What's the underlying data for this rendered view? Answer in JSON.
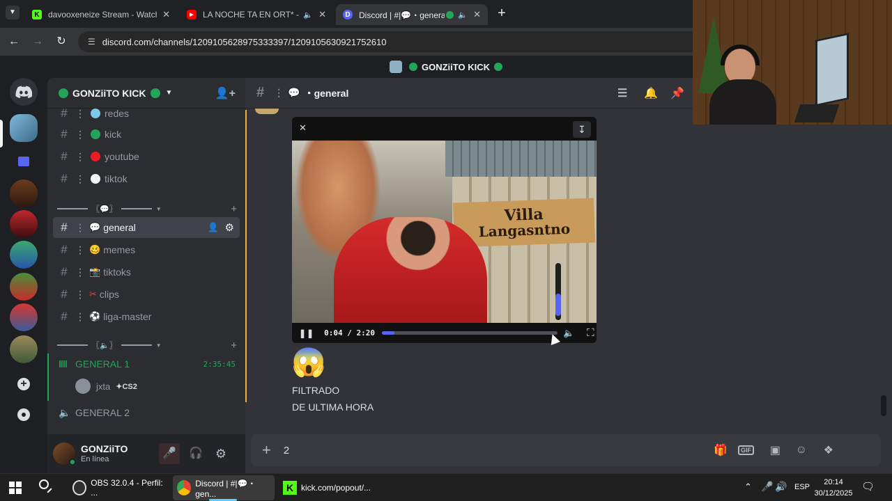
{
  "browser": {
    "tabs": [
      {
        "title": "davooxeneize Stream - Watch Li",
        "favicon": "K",
        "fav_color": "#53fc18",
        "active": false
      },
      {
        "title": "LA NOCHE TA EN ORT* - TU",
        "favicon": "▶",
        "fav_color": "#ff0000",
        "active": false
      },
      {
        "title": "Discord | #|💬・general | ",
        "favicon": "D",
        "fav_color": "#5865f2",
        "active": true
      }
    ],
    "new_tab": "+",
    "url": "discord.com/channels/1209105628975333397/1209105630921752610"
  },
  "server_banner": {
    "name": "GONZiiTO KICK"
  },
  "sidebar": {
    "server_name": "GONZiiTO KICK",
    "channels_top": [
      {
        "name": "redes",
        "emoji_color": "#7fc8e8"
      },
      {
        "name": "kick",
        "emoji_color": "#23a559"
      },
      {
        "name": "youtube",
        "emoji_color": "#ed1c24"
      },
      {
        "name": "tiktok",
        "emoji_color": "#f2f3f5"
      }
    ],
    "channels_mid": [
      {
        "name": "general",
        "emoji": "💬",
        "selected": true
      },
      {
        "name": "memes",
        "emoji": "🥴"
      },
      {
        "name": "tiktoks",
        "emoji": "📸"
      },
      {
        "name": "clips",
        "emoji": "✂"
      },
      {
        "name": "liga-master",
        "emoji": "⚽"
      }
    ],
    "voice": [
      {
        "name": "GENERAL 1",
        "time": "2:35:45",
        "active": true
      },
      {
        "name": "GENERAL 2",
        "active": false
      }
    ],
    "voice_user": {
      "name": "jxta",
      "badge": "CS2"
    },
    "user": {
      "name": "GONZiiTO",
      "status": "En línea"
    }
  },
  "chat": {
    "channel_name": "general",
    "video": {
      "time": "0:04 / 2:20",
      "progress": 0.07,
      "sign_line1": "Villa",
      "sign_line2": "Langasntno"
    },
    "reaction_emoji": "😱",
    "message_lines": [
      "FILTRADO",
      "DE ULTIMA HORA"
    ],
    "composer_value": "2"
  },
  "taskbar": {
    "items": [
      {
        "label": "OBS 32.0.4 - Perfil: ..."
      },
      {
        "label": "Discord | #|💬・gen..."
      },
      {
        "label": "kick.com/popout/..."
      }
    ],
    "lang": "ESP",
    "time": "20:14",
    "date": "30/12/2025"
  }
}
